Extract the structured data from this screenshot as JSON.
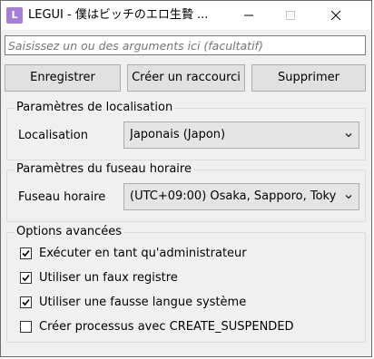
{
  "window": {
    "icon_letter": "L",
    "title": "LEGUI - 僕はビッチのエロ生贄 ..."
  },
  "args": {
    "placeholder": "Saisissez un ou des arguments ici (facultatif)",
    "value": ""
  },
  "buttons": {
    "save": "Enregistrer",
    "shortcut": "Créer un raccourci",
    "delete": "Supprimer"
  },
  "locale_group": {
    "title": "Paramètres de localisation",
    "label": "Localisation",
    "selected": "Japonais (Japon)"
  },
  "timezone_group": {
    "title": "Paramètres du fuseau horaire",
    "label": "Fuseau horaire",
    "selected": "(UTC+09:00) Osaka, Sapporo, Toky"
  },
  "advanced_group": {
    "title": "Options avancées",
    "options": [
      {
        "label": "Exécuter en tant qu'administrateur",
        "checked": true
      },
      {
        "label": "Utiliser un faux registre",
        "checked": true
      },
      {
        "label": "Utiliser une fausse langue système",
        "checked": true
      },
      {
        "label": "Créer processus avec CREATE_SUSPENDED",
        "checked": false
      }
    ]
  }
}
